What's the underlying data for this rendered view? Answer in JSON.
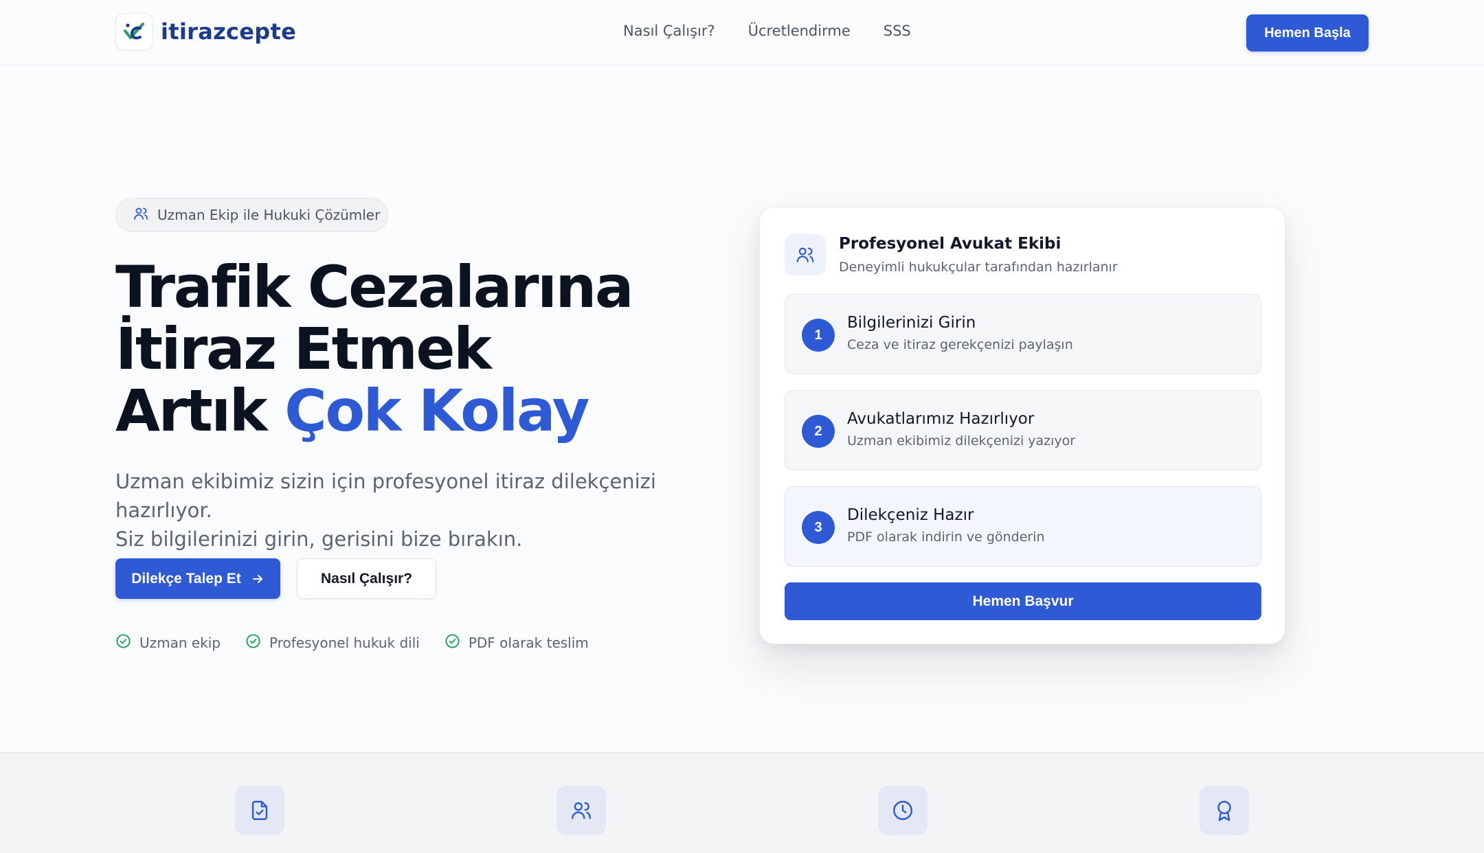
{
  "brand": {
    "name": "itirazcepte",
    "colors": {
      "primary": "#2f5ad6",
      "brand_text": "#1c3b8a",
      "logo_green": "#22a060",
      "check_green": "#22a060"
    }
  },
  "nav": {
    "items": [
      {
        "label": "Nasıl Çalışır?"
      },
      {
        "label": "Ücretlendirme"
      },
      {
        "label": "SSS"
      }
    ],
    "cta_label": "Hemen Başla"
  },
  "hero": {
    "badge_icon": "users-icon",
    "badge_text": "Uzman Ekip ile Hukuki Çözümler",
    "title_line1": "Trafik Cezalarına",
    "title_line2": "İtiraz Etmek",
    "title_line3_prefix": "Artık ",
    "title_line3_accent": "Çok Kolay",
    "subtitle_line1": "Uzman ekibimiz sizin için profesyonel itiraz dilekçenizi hazırlıyor.",
    "subtitle_line2": "Siz bilgilerinizi girin, gerisini bize bırakın.",
    "primary_button": "Dilekçe Talep Et",
    "secondary_button": "Nasıl Çalışır?",
    "features": [
      {
        "icon": "check-circle-icon",
        "label": "Uzman ekip"
      },
      {
        "icon": "check-circle-icon",
        "label": "Profesyonel hukuk dili"
      },
      {
        "icon": "check-circle-icon",
        "label": "PDF olarak teslim"
      }
    ]
  },
  "card": {
    "icon": "users-icon",
    "title": "Profesyonel Avukat Ekibi",
    "subtitle": "Deneyimli hukukçular tarafından hazırlanır",
    "steps": [
      {
        "number": "1",
        "title": "Bilgilerinizi Girin",
        "description": "Ceza ve itiraz gerekçenizi paylaşın"
      },
      {
        "number": "2",
        "title": "Avukatlarımız Hazırlıyor",
        "description": "Uzman ekibimiz dilekçenizi yazıyor"
      },
      {
        "number": "3",
        "title": "Dilekçeniz Hazır",
        "description": "PDF olarak indirin ve gönderin"
      }
    ],
    "cta_label": "Hemen Başvur"
  },
  "band": {
    "icons": [
      "file-check-icon",
      "users-icon",
      "clock-icon",
      "award-icon"
    ]
  }
}
